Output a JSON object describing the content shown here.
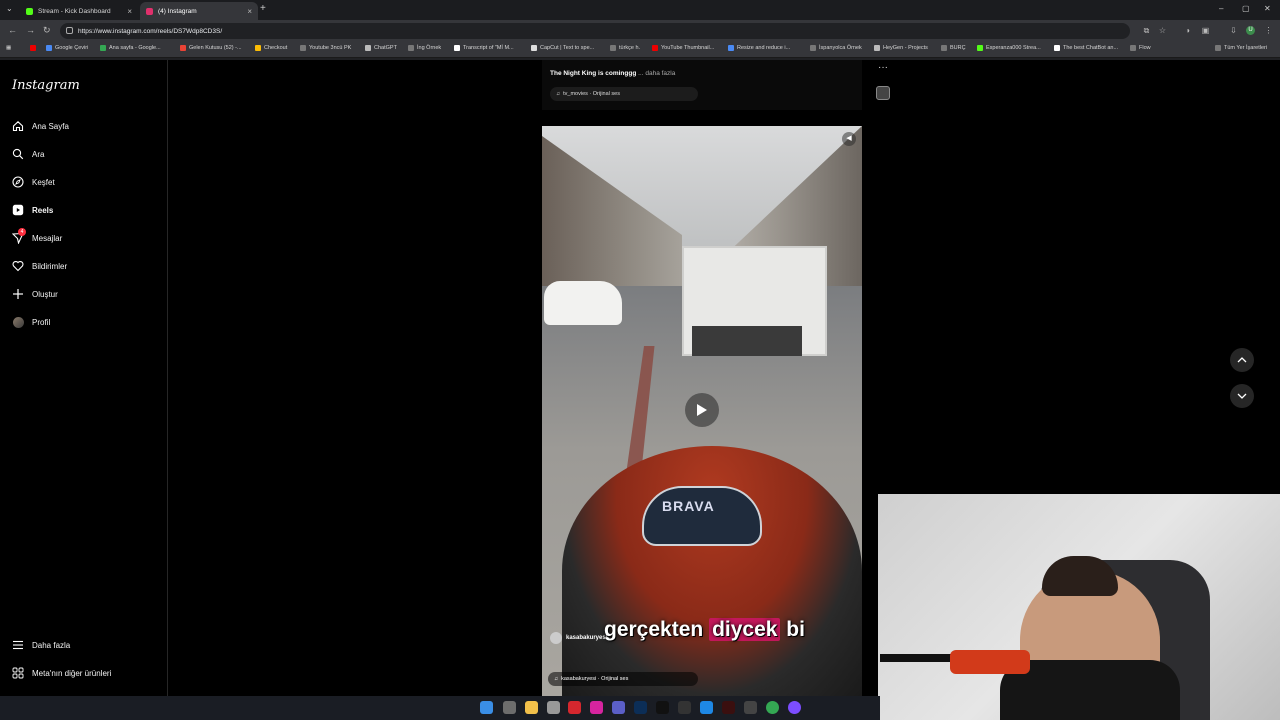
{
  "browser": {
    "tabs": [
      {
        "label": "Stream - Kick Dashboard",
        "color": "#53fc18"
      },
      {
        "label": "(4) Instagram",
        "color": "#e1306c"
      }
    ],
    "url": "https://www.instagram.com/reels/DS7Wdp8CD3S/",
    "bookmarks": [
      "Google Çeviri",
      "Ana sayfa - Google...",
      "Gelen Kutusu (52) -...",
      "Checkout",
      "Youtube 3ncü PK",
      "ChatGPT",
      "İng Örnek",
      "Transcript of \"Mİ M...",
      "CapCut | Text to spe...",
      "türkçe h.",
      "YouTube Thumbnail...",
      "Resize and reduce i...",
      "İspanyolca Örnek",
      "HeyGen - Projects",
      "BURÇ",
      "Esperanza000 Strea...",
      "The best ChatBot an...",
      "Flow",
      "Tüm Yer İşaretleri"
    ]
  },
  "sidebar": {
    "logo": "Instagram",
    "items": [
      {
        "label": "Ana Sayfa",
        "icon": "home-icon"
      },
      {
        "label": "Ara",
        "icon": "search-icon"
      },
      {
        "label": "Keşfet",
        "icon": "compass-icon"
      },
      {
        "label": "Reels",
        "icon": "reels-icon"
      },
      {
        "label": "Mesajlar",
        "icon": "messenger-icon"
      },
      {
        "label": "Bildirimler",
        "icon": "heart-icon"
      },
      {
        "label": "Oluştur",
        "icon": "plus-icon"
      },
      {
        "label": "Profil",
        "icon": "avatar"
      }
    ],
    "messages_badge": "4",
    "footer": [
      {
        "label": "Daha fazla",
        "icon": "menu-icon"
      },
      {
        "label": "Meta'nın diğer ürünleri",
        "icon": "meta-icon"
      }
    ]
  },
  "previous_post": {
    "caption": "The Night King is cominggg",
    "more": "... daha fazla",
    "audio": "tv_movies · Orijinal ses"
  },
  "reel": {
    "subtitle_pre": "gerçekten",
    "subtitle_hl": "diycek",
    "subtitle_post": "bi",
    "username": "kasabakuryesi",
    "audio": "kasabakuryesi · Orijinal ses",
    "dash_text": "BRAVA"
  }
}
